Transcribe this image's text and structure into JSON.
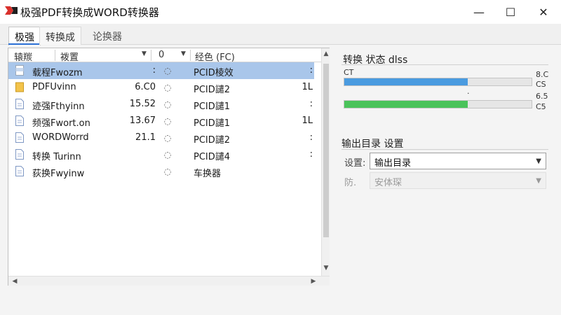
{
  "window": {
    "title": "极强PDF转换成WORD转换器",
    "minimize_glyph": "—",
    "maximize_glyph": "☐",
    "close_glyph": "✕"
  },
  "tabs": [
    {
      "label": "极强"
    },
    {
      "label": "转换成"
    },
    {
      "label": "论换器"
    }
  ],
  "file_list": {
    "headers": {
      "name": "辕羰",
      "size": "袯置",
      "status": "0",
      "type": "经色 (FC)"
    },
    "rows": [
      {
        "name": "载程Fwozm",
        "size": ":",
        "status": "◌",
        "type": "PCID棱效",
        "extra": ":",
        "icon": "pdf-icon",
        "selected": true
      },
      {
        "name": "PDFUvinn",
        "size": "6.C0",
        "status": "◌",
        "type": "PCID譴2",
        "extra": "1L",
        "icon": "folder-icon",
        "selected": false
      },
      {
        "name": "迹强Fthyinn",
        "size": "15.52",
        "status": "◌",
        "type": "PCID譴1",
        "extra": ":",
        "icon": "doc-icon",
        "selected": false
      },
      {
        "name": "频强Fwort.on",
        "size": "13.67",
        "status": "◌",
        "type": "PCID譴1",
        "extra": "1L",
        "icon": "doc-icon",
        "selected": false
      },
      {
        "name": "WORDWorrd",
        "size": "21.1",
        "status": "◌",
        "type": "PCID譴2",
        "extra": ":",
        "icon": "doc-icon",
        "selected": false
      },
      {
        "name": "转换 Turinn",
        "size": "",
        "status": "◌",
        "type": "PCID譴4",
        "extra": ":",
        "icon": "doc-icon",
        "selected": false
      },
      {
        "name": "荻换Fwyinw",
        "size": "",
        "status": "◌",
        "type": "车换器",
        "extra": "",
        "icon": "doc-icon",
        "selected": false
      }
    ]
  },
  "status_panel": {
    "title": "转换 状态 dlss",
    "bar1": {
      "label": "CT",
      "value_top": "8.C",
      "value_bottom": "CS",
      "progress": 0.66
    },
    "mid_mark": "·",
    "bar2": {
      "value_top": "6.5",
      "value_bottom": "C5",
      "progress": 0.66
    }
  },
  "output_settings": {
    "title": "输出目录 设置",
    "row1": {
      "label": "设置:",
      "value": "输出目录"
    },
    "row2": {
      "label": "防.",
      "value": "安体琛"
    }
  },
  "colors": {
    "accent": "#2a6ed3",
    "selection": "#a9c6ea",
    "bar_blue": "#4a9be0",
    "bar_green": "#4ac35a"
  }
}
